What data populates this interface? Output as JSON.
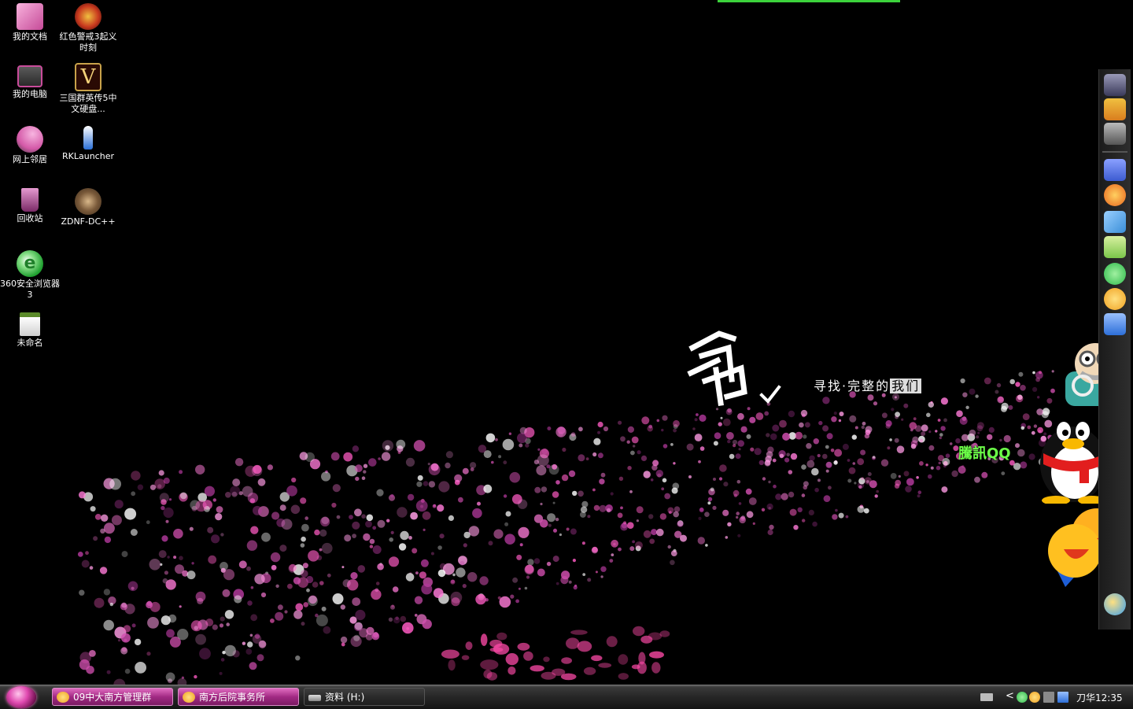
{
  "desktop_icons": [
    {
      "label": "我的文档",
      "icon": "my-documents-icon",
      "color": "#e76bb6"
    },
    {
      "label": "红色警戒3起义时刻",
      "icon": "red-alert-3-icon",
      "color": "#c8381e"
    },
    {
      "label": "我的电脑",
      "icon": "my-computer-icon",
      "color": "#c94c9b"
    },
    {
      "label": "三国群英传5中文硬盘...",
      "icon": "sanguo-5-icon",
      "color": "#7a1d0c"
    },
    {
      "label": "网上邻居",
      "icon": "network-places-icon",
      "color": "#d459a8"
    },
    {
      "label": "RKLauncher",
      "icon": "rocket-launcher-icon",
      "color": "#2a6fd6"
    },
    {
      "label": "回收站",
      "icon": "recycle-bin-icon",
      "color": "#b05098"
    },
    {
      "label": "ZDNF-DC++",
      "icon": "dcpp-icon",
      "color": "#7a5a3a"
    },
    {
      "label": "360安全浏览器 3",
      "icon": "browser-360-icon",
      "color": "#3bbf3b"
    },
    {
      "label": "未命名",
      "icon": "jpg-image-icon",
      "color": "#e7e7e7"
    }
  ],
  "wallpaper": {
    "slogan_prefix": "寻找·完整的",
    "slogan_highlight": "我们",
    "calligraphy": "鸟"
  },
  "qq": {
    "logo_text": "騰訊QQ"
  },
  "dock_icons": [
    {
      "icon": "game-portrait-icon",
      "color": "#6c6c8a"
    },
    {
      "icon": "rollercoaster-tycoon-2-icon",
      "color": "#d97d1e"
    },
    {
      "icon": "city-game-icon",
      "color": "#7a7a7a"
    },
    {
      "icon": "document-viewer-icon",
      "color": "#3c5bd1"
    },
    {
      "icon": "media-player-icon",
      "color": "#e8641c"
    },
    {
      "icon": "bird-app-icon",
      "color": "#3a8ed8"
    },
    {
      "icon": "printer-icon",
      "color": "#7bc64a"
    },
    {
      "icon": "pen-app-icon",
      "color": "#2db84a"
    },
    {
      "icon": "music-app-icon",
      "color": "#f0a020"
    },
    {
      "icon": "hearing-app-icon",
      "color": "#2d6fd8"
    }
  ],
  "taskbar": {
    "tasks": [
      {
        "label": "09中大南方管理群",
        "icon": "qq-group-icon",
        "style": "pink"
      },
      {
        "label": "南方后院事务所",
        "icon": "qq-group-icon",
        "style": "pink"
      },
      {
        "label": "资料 (H:)",
        "icon": "drive-icon",
        "style": "gray"
      }
    ],
    "clock": "刀华12:35",
    "tray_arrow": "<"
  },
  "colors": {
    "accent_pink": "#ff77d8",
    "taskbar_pink": "#a22a84",
    "top_bar_green": "#3cd23c"
  }
}
